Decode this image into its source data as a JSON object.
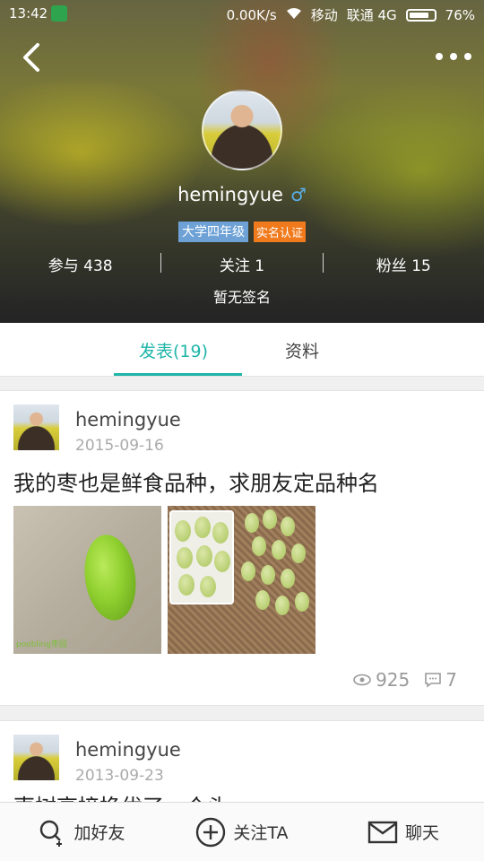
{
  "status_bar": {
    "time": "13:42",
    "network_speed": "0.00K/s",
    "carrier1": "移动",
    "carrier2": "联通 4G",
    "battery": "76%"
  },
  "profile": {
    "username": "hemingyue",
    "gender_symbol": "♂",
    "grade_badge": "大学四年级",
    "verified_badge": "实名认证",
    "stats": {
      "participate": "参与 438",
      "following": "关注 1",
      "fans": "粉丝 15"
    },
    "signature": "暂无签名"
  },
  "tabs": {
    "posts": "发表(19)",
    "info": "资料"
  },
  "posts": [
    {
      "author": "hemingyue",
      "date": "2015-09-16",
      "text": "我的枣也是鲜食品种，求朋友定品种名",
      "image_watermark": "poobling枣园",
      "views": "925",
      "comments": "7"
    },
    {
      "author": "hemingyue",
      "date": "2013-09-23",
      "text": "枣树高接换优了一个头"
    }
  ],
  "bottom_bar": {
    "add_friend": "加好友",
    "follow": "关注TA",
    "chat": "聊天"
  },
  "colors": {
    "accent": "#1fb5a8",
    "grade_badge_bg": "#6ea2d6",
    "verified_badge_bg": "#f07a1c"
  }
}
